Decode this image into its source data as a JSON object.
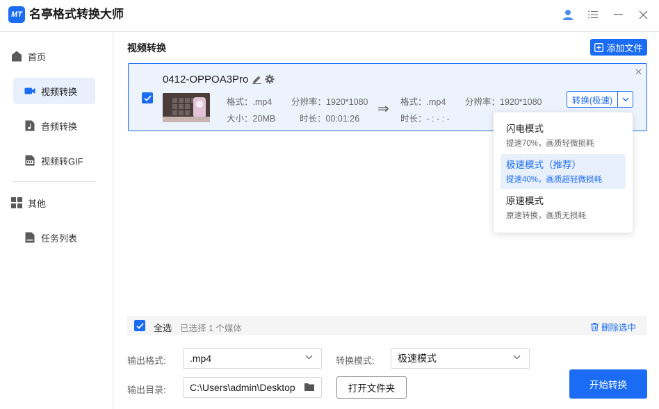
{
  "app": {
    "title": "名亭格式转换大师",
    "logo_text": "MT"
  },
  "sidebar": {
    "items": [
      {
        "label": "首页",
        "icon": "home-icon"
      },
      {
        "label": "视频转换",
        "icon": "video-icon",
        "active": true
      },
      {
        "label": "音频转换",
        "icon": "music-file-icon"
      },
      {
        "label": "视频转GIF",
        "icon": "gif-file-icon"
      },
      {
        "label": "其他",
        "icon": "grid-icon"
      },
      {
        "label": "任务列表",
        "icon": "task-file-icon"
      }
    ]
  },
  "main": {
    "section_title": "视频转换",
    "add_file_label": "添加文件"
  },
  "file": {
    "name": "0412-OPPOA3Pro",
    "src_format": "格式：.mp4",
    "src_resolution": "分辨率：1920*1080",
    "src_size": "大小：20MB",
    "src_duration": "时长：00:01:26",
    "dst_format": "格式：.mp4",
    "dst_resolution": "分辨率：1920*1080",
    "dst_duration": "时长：- : - : -",
    "convert_label": "转换(极速)",
    "checked": true
  },
  "mode_dropdown": {
    "options": [
      {
        "title": "闪电模式",
        "desc": "提速70%，画质轻微损耗"
      },
      {
        "title": "极速模式（推荐）",
        "desc": "提速40%，画质超轻微损耗",
        "selected": true
      },
      {
        "title": "原速模式",
        "desc": "原速转换，画质无损耗"
      }
    ]
  },
  "selection": {
    "select_all_label": "全选",
    "selected_count_text": "已选择 1 个媒体",
    "delete_label": "删除选中"
  },
  "output": {
    "format_label": "输出格式:",
    "format_value": ".mp4",
    "mode_label": "转换模式:",
    "mode_value": "极速模式",
    "dir_label": "输出目录:",
    "dir_value": "C:\\Users\\admin\\Desktop",
    "open_folder_label": "打开文件夹",
    "start_label": "开始转换"
  },
  "colors": {
    "accent": "#1a6cf5",
    "card_bg": "#edf3fd",
    "active_nav_bg": "#e8effd"
  }
}
